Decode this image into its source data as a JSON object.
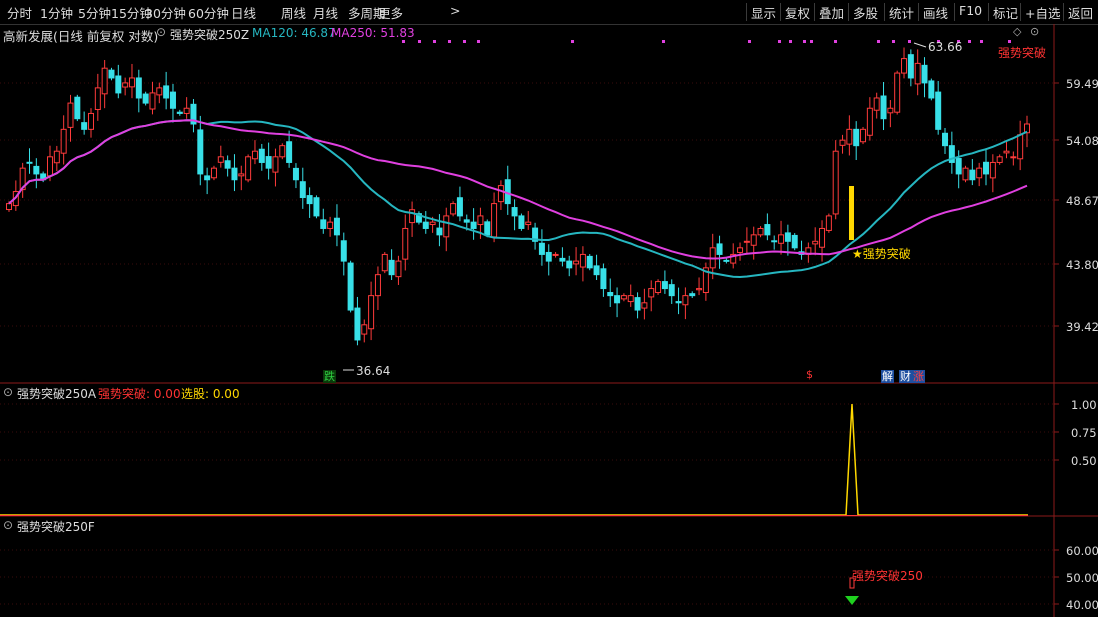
{
  "toolbar": {
    "periods": [
      "分时",
      "1分钟",
      "5分钟",
      "15分钟",
      "30分钟",
      "60分钟",
      "日线",
      "周线",
      "月线",
      "多周期",
      "更多"
    ],
    "more_arrow": ">",
    "right": [
      "显示",
      "复权",
      "叠加",
      "多股",
      "统计",
      "画线",
      "F10",
      "标记",
      "+自选",
      "返回"
    ]
  },
  "main_panel": {
    "stock_title": "高新发展(日线 前复权 对数)",
    "indicator_name": "强势突破250Z",
    "ma120_label": "MA120: 46.87",
    "ma250_label": "MA250: 51.83",
    "high_label": "63.66",
    "low_label": "36.64",
    "signal_label": "★强势突破",
    "corner_label": "强势突破",
    "y_ticks": [
      "59.49",
      "54.08",
      "48.67",
      "43.80",
      "39.42"
    ],
    "markers": [
      {
        "text": "跌",
        "color": "#2ecc40",
        "bg": "#0a3a0a"
      },
      {
        "text": "$",
        "color": "#ff3333",
        "bg": "#000"
      },
      {
        "text": "解",
        "color": "#fff",
        "bg": "#1f4fa0"
      },
      {
        "text": "财",
        "color": "#fff",
        "bg": "#1f4fa0"
      },
      {
        "text": "涨",
        "color": "#ff4040",
        "bg": "#1f4fa0"
      }
    ],
    "colors": {
      "up": "#ff3b3b",
      "down": "#38e0e8",
      "ma120": "#26b6c0",
      "ma250": "#e040e0",
      "signal": "#ffd800"
    }
  },
  "panel2": {
    "name": "强势突破250A",
    "val1_label": "强势突破: 0.00",
    "val2_label": "选股: 0.00",
    "y_ticks": [
      "1.00",
      "0.75",
      "0.50"
    ],
    "series_name": "强势突破"
  },
  "panel3": {
    "name": "强势突破250F",
    "signal_label": "强势突破250",
    "y_ticks": [
      "60.00",
      "50.00",
      "40.00"
    ]
  }
}
